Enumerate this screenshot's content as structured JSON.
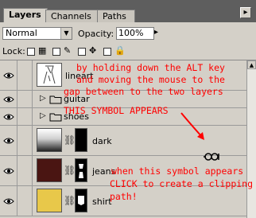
{
  "tabs": [
    {
      "label": "Layers"
    },
    {
      "label": "Channels"
    },
    {
      "label": "Paths"
    }
  ],
  "panel_menu_icon": "triangle-right-icon",
  "blend_mode": {
    "value": "Normal"
  },
  "opacity": {
    "label": "Opacity:",
    "value": "100%"
  },
  "lock": {
    "label": "Lock:"
  },
  "layers": [
    {
      "name": "lineart",
      "type": "layer",
      "visible": true
    },
    {
      "name": "guitar",
      "type": "group",
      "visible": true
    },
    {
      "name": "shoes",
      "type": "group",
      "visible": true
    },
    {
      "name": "dark",
      "type": "layer",
      "visible": true
    },
    {
      "name": "jeans",
      "type": "layer",
      "visible": true
    },
    {
      "name": "shirt",
      "type": "layer",
      "visible": true
    }
  ],
  "annotations": {
    "line1": "by holding down the ALT key",
    "line2": "and moving the mouse to the",
    "line3": "gap between to the two layers",
    "line4": "THIS SYMBOL APPEARS",
    "line5": "when this symbol appears",
    "line6": "CLICK to create a clipping",
    "line7": "path!"
  },
  "colors": {
    "annotation": "#ff0000",
    "jeans_thumb": "#4a1512",
    "shirt_thumb": "#e8c84a"
  }
}
